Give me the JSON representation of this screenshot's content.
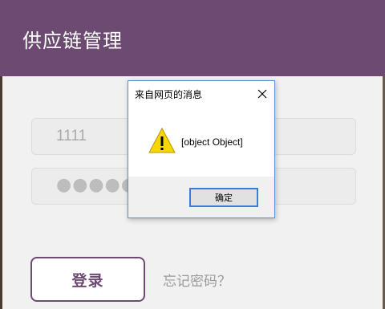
{
  "header": {
    "title": "供应链管理",
    "color": "#6c4a72"
  },
  "login_form": {
    "username_value": "1111",
    "password_masked": "●●●●●",
    "login_label": "登录",
    "forgot_label": "忘记密码？"
  },
  "dialog": {
    "title": "来自网页的消息",
    "message": "[object Object]",
    "ok_label": "确定",
    "icon": "warning-icon",
    "close_icon": "close-icon"
  }
}
